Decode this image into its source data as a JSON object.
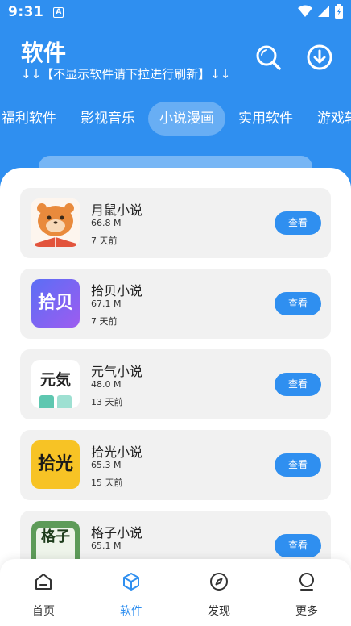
{
  "status_bar": {
    "time": "9:31",
    "notif_glyph": "A"
  },
  "header": {
    "title": "软件",
    "hint": "↓↓【不显示软件请下拉进行刷新】↓↓"
  },
  "tabs": [
    {
      "label": "福利软件"
    },
    {
      "label": "影视音乐"
    },
    {
      "label": "小说漫画",
      "active": true
    },
    {
      "label": "实用软件"
    },
    {
      "label": "游戏软件"
    }
  ],
  "apps": [
    {
      "name": "月鼠小说",
      "size": "66.8 M",
      "time": "7 天前",
      "action": "查看",
      "icon": "hamster-icon"
    },
    {
      "name": "拾贝小说",
      "size": "67.1 M",
      "time": "7 天前",
      "action": "查看",
      "icon": "shibei-icon",
      "icon_text": "拾贝"
    },
    {
      "name": "元气小说",
      "size": "48.0 M",
      "time": "13 天前",
      "action": "查看",
      "icon": "yuanqi-icon",
      "icon_text": "元気"
    },
    {
      "name": "拾光小说",
      "size": "65.3 M",
      "time": "15 天前",
      "action": "查看",
      "icon": "shiguang-icon",
      "icon_text": "拾光"
    },
    {
      "name": "格子小说",
      "size": "65.1 M",
      "time": "",
      "action": "查看",
      "icon": "gezi-icon",
      "icon_text": "格子"
    }
  ],
  "bottom_nav": [
    {
      "label": "首页",
      "icon": "home-icon"
    },
    {
      "label": "软件",
      "icon": "cube-icon",
      "active": true
    },
    {
      "label": "发现",
      "icon": "compass-icon"
    },
    {
      "label": "更多",
      "icon": "more-icon"
    }
  ],
  "colors": {
    "primary": "#2f8ff0",
    "card_bg": "#f1f1f1"
  }
}
